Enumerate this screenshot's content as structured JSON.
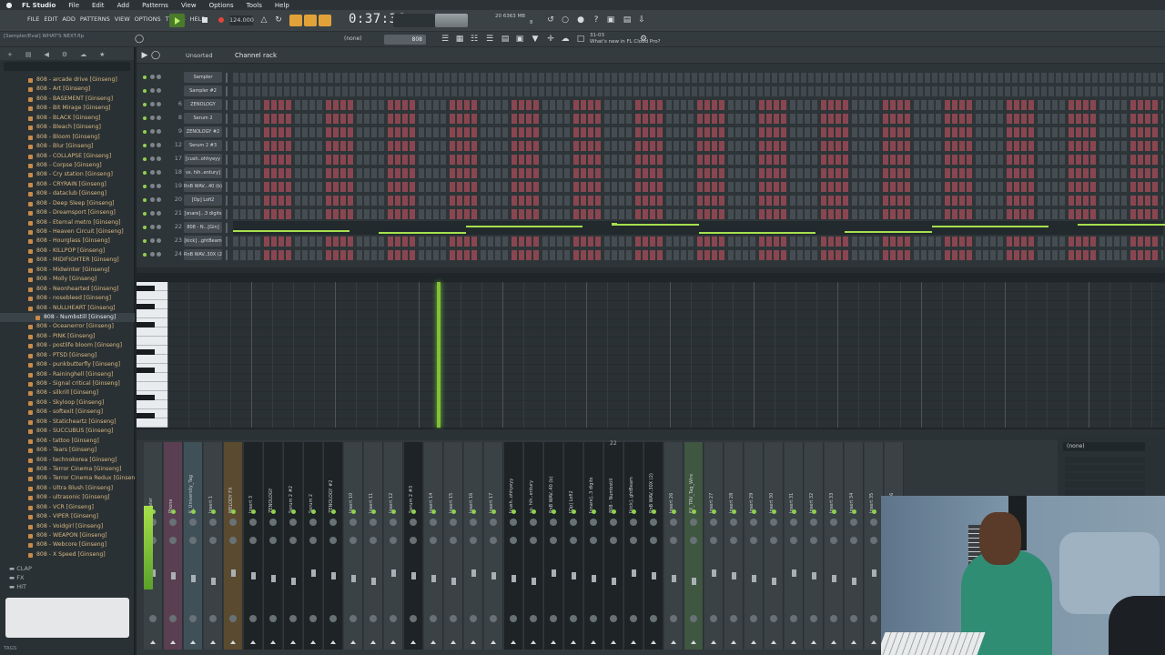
{
  "menubar": {
    "app_name": "FL Studio",
    "items": [
      "File",
      "Edit",
      "Add",
      "Patterns",
      "View",
      "Options",
      "Tools",
      "Help"
    ]
  },
  "toolbar": {
    "fl_menus": [
      "FILE",
      "EDIT",
      "ADD",
      "PATTERNS",
      "VIEW",
      "OPTIONS",
      "TOOLS",
      "HELP"
    ],
    "tempo": "124.000",
    "time": "0:37:36",
    "memory": "6363 MB",
    "cpu_count": "8",
    "cpu_num": "20"
  },
  "toolbar2": {
    "hint": "[Sampler/Eval] WHAT'S NEXT.flp",
    "snap": "(none)",
    "pattern": "808",
    "news": "What's new in FL Cloud Pro?",
    "news_date": "31-03"
  },
  "browser": {
    "items": [
      "808 - arcade drive [Ginseng]",
      "808 - Art [Ginseng]",
      "808 - BASEMENT [Ginseng]",
      "808 - Bit Mirage [Ginseng]",
      "808 - BLACK [Ginseng]",
      "808 - Bleach [Ginseng]",
      "808 - Bloom [Ginseng]",
      "808 - Blur [Ginseng]",
      "808 - COLLAPSE [Ginseng]",
      "808 - Corpse [Ginseng]",
      "808 - Cry station [Ginseng]",
      "808 - CRYRAIN [Ginseng]",
      "808 - dataclub [Ginseng]",
      "808 - Deep Sleep [Ginseng]",
      "808 - Dreamsport [Ginseng]",
      "808 - Eternal metro [Ginseng]",
      "808 - Heaven Circuit [Ginseng]",
      "808 - Hourglass [Ginseng]",
      "808 - KILLPOP [Ginseng]",
      "808 - MIDIFIGHTER [Ginseng]",
      "808 - Midwinter [Ginseng]",
      "808 - Molly [Ginseng]",
      "808 - Neonhearted [Ginseng]",
      "808 - nosebleed [Ginseng]",
      "808 - NULLHEART [Ginseng]",
      "808 - Numbstill [Ginseng]",
      "808 - Oceanerror [Ginseng]",
      "808 - PINK [Ginseng]",
      "808 - postlife bloom [Ginseng]",
      "808 - PTSD [Ginseng]",
      "808 - punkbutterfly [Ginseng]",
      "808 - Raininghell [Ginseng]",
      "808 - Signal critical [Ginseng]",
      "808 - silkrill [Ginseng]",
      "808 - Skyloop [Ginseng]",
      "808 - softexit [Ginseng]",
      "808 - Staticheartz [Ginseng]",
      "808 - SUCCUBUS [Ginseng]",
      "808 - tattoo [Ginseng]",
      "808 - Tears [Ginseng]",
      "808 - technokorea [Ginseng]",
      "808 - Terror Cinema [Ginseng]",
      "808 - Terror Cinema Redux [Ginseng]",
      "808 - Ultra Blush [Ginseng]",
      "808 - ultrasonic [Ginseng]",
      "808 - VCR [Ginseng]",
      "808 - VIPER [Ginseng]",
      "808 - Voidgirl [Ginseng]",
      "808 - WEAPON [Ginseng]",
      "808 - Webcore [Ginseng]",
      "808 - X Speed [Ginseng]"
    ],
    "selected_index": 25,
    "folders": [
      "CLAP",
      "FX",
      "HIT"
    ],
    "tags": "TAGS"
  },
  "channel_rack": {
    "filter": "Unsorted",
    "title": "Channel rack",
    "channels": [
      {
        "num": "",
        "name": "Sampler"
      },
      {
        "num": "",
        "name": "Sampler #2"
      },
      {
        "num": "6",
        "name": "ZENOLOGY"
      },
      {
        "num": "8",
        "name": "Serum 2"
      },
      {
        "num": "9",
        "name": "ZENOLOGY #2"
      },
      {
        "num": "12",
        "name": "Serum 2 #3"
      },
      {
        "num": "17",
        "name": "[cush..ohhyeyy"
      },
      {
        "num": "18",
        "name": "vs. hih..entury]"
      },
      {
        "num": "19",
        "name": "RnB WAV...40 (b)"
      },
      {
        "num": "20",
        "name": "[Op] Lofi2"
      },
      {
        "num": "21",
        "name": "[snare]...3 digits"
      },
      {
        "num": "22",
        "name": "808 - N...[Gin]"
      },
      {
        "num": "23",
        "name": "[kick] ..ghtBeam"
      },
      {
        "num": "24",
        "name": "RnB WAV..30X (2)"
      }
    ]
  },
  "mixer": {
    "strips": [
      {
        "label": "Master",
        "style": "normal"
      },
      {
        "label": "Phone",
        "style": "purple"
      },
      {
        "label": "K_University_Tag",
        "style": "blue"
      },
      {
        "label": "Insert 1",
        "style": "normal"
      },
      {
        "label": "MELODY FX",
        "style": "orange"
      },
      {
        "label": "Insert 3",
        "style": "dark"
      },
      {
        "label": "ZENOLOGY",
        "style": "dark"
      },
      {
        "label": "Serum 2 #2",
        "style": "dark"
      },
      {
        "label": "Serum 2",
        "style": "dark"
      },
      {
        "label": "ZENOLOGY #2",
        "style": "dark"
      },
      {
        "label": "Insert 10",
        "style": "normal"
      },
      {
        "label": "Insert 11",
        "style": "normal"
      },
      {
        "label": "Insert 12",
        "style": "normal"
      },
      {
        "label": "Serum 2 #3",
        "style": "dark"
      },
      {
        "label": "Insert 14",
        "style": "normal"
      },
      {
        "label": "Insert 15",
        "style": "normal"
      },
      {
        "label": "Insert 16",
        "style": "normal"
      },
      {
        "label": "Insert 17",
        "style": "normal"
      },
      {
        "label": "[cush..ohhyeyy",
        "style": "dark"
      },
      {
        "label": "vs. hih..entury",
        "style": "dark"
      },
      {
        "label": "RnB WAV..40 (b)",
        "style": "dark"
      },
      {
        "label": "[Op] Lofi2",
        "style": "dark"
      },
      {
        "label": "[snare]..3 digits",
        "style": "dark"
      },
      {
        "label": "808 - Numbstill",
        "style": "dark"
      },
      {
        "label": "[kick]..ghtBeam",
        "style": "dark"
      },
      {
        "label": "RnB WAV..30X (2)",
        "style": "dark"
      },
      {
        "label": "Insert 26",
        "style": "normal"
      },
      {
        "label": "FX_TRV_Tag_Wire",
        "style": "green"
      },
      {
        "label": "Insert 27",
        "style": "normal"
      },
      {
        "label": "Insert 28",
        "style": "normal"
      },
      {
        "label": "Insert 29",
        "style": "normal"
      },
      {
        "label": "Insert 30",
        "style": "normal"
      },
      {
        "label": "Insert 31",
        "style": "normal"
      },
      {
        "label": "Insert 32",
        "style": "normal"
      },
      {
        "label": "Insert 33",
        "style": "normal"
      },
      {
        "label": "Insert 34",
        "style": "normal"
      },
      {
        "label": "Insert 35",
        "style": "normal"
      },
      {
        "label": "Insert 36",
        "style": "normal"
      }
    ],
    "fx_select": "(none)",
    "marker": "22"
  },
  "colors": {
    "accent_green": "#7ec436",
    "step_red": "#8a4650",
    "orange": "#e2a23a"
  }
}
